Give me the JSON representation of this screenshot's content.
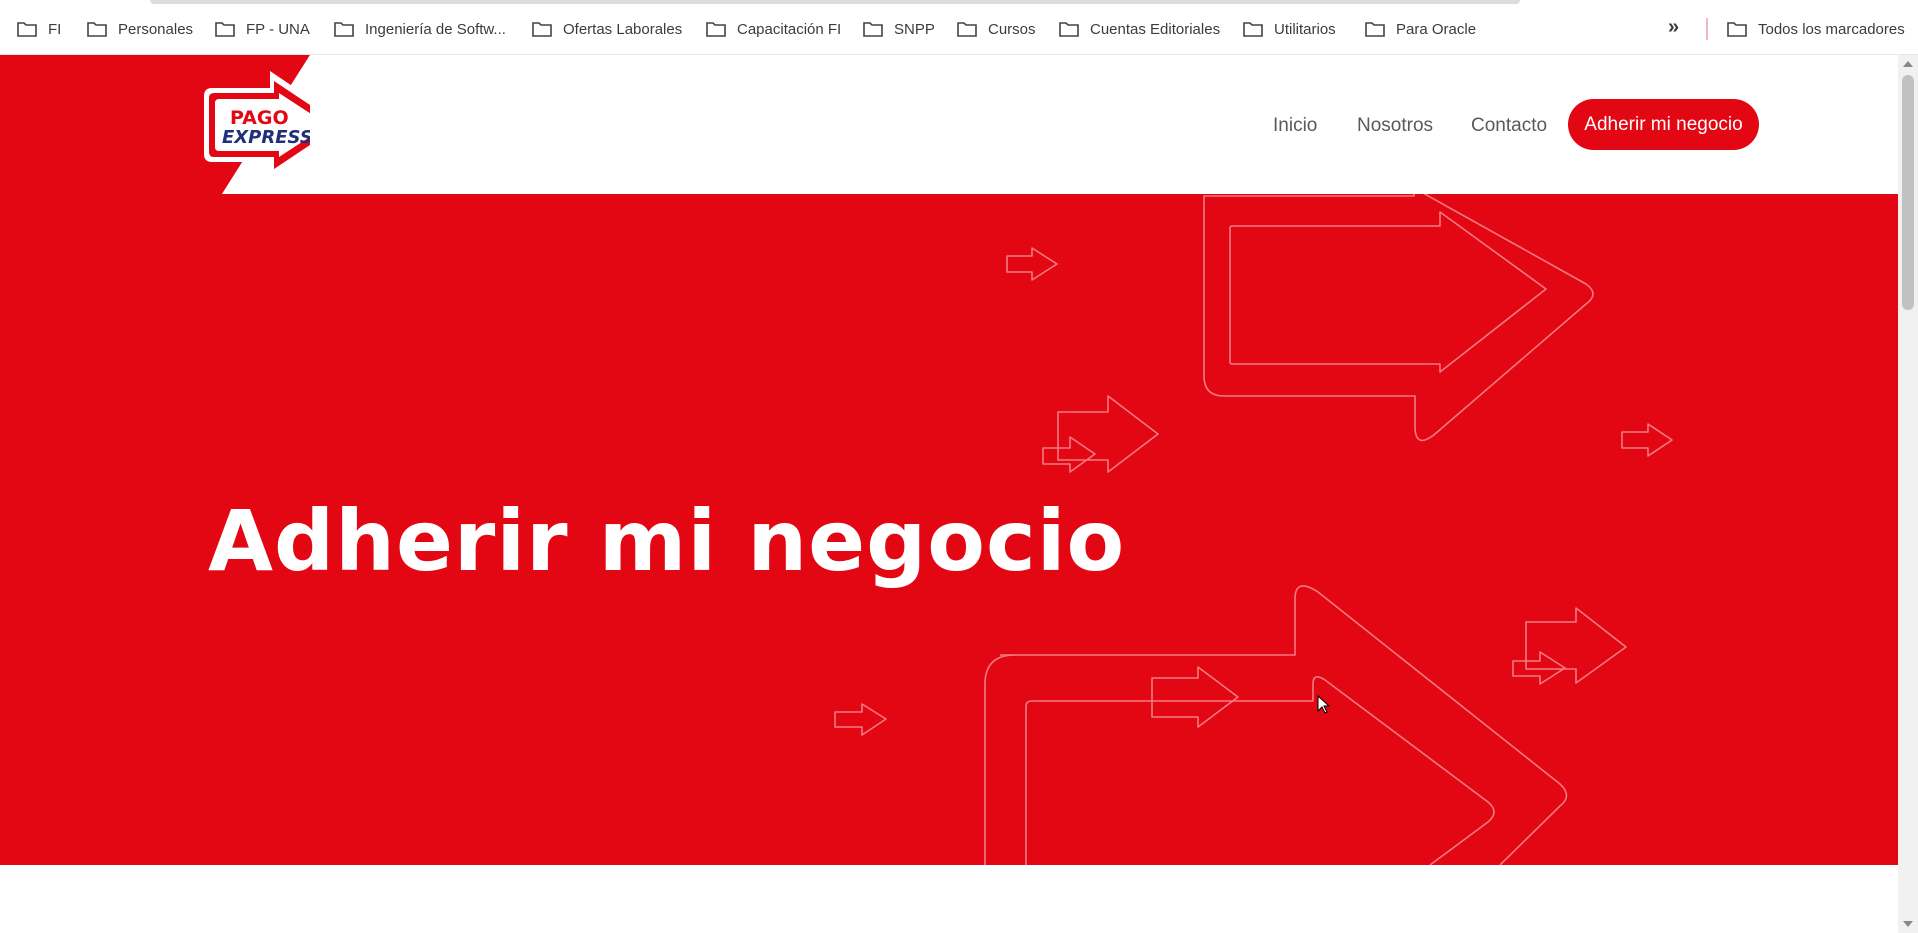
{
  "bookmarks": {
    "items": [
      "FI",
      "Personales",
      "FP - UNA",
      "Ingeniería de Softw...",
      "Ofertas Laborales",
      "Capacitación FI",
      "SNPP",
      "Cursos",
      "Cuentas Editoriales",
      "Utilitarios",
      "Para Oracle"
    ],
    "more_icon": "double-chevron-right-icon",
    "all_bookmarks": "Todos los marcadores"
  },
  "header": {
    "logo": {
      "line1": "PAGO",
      "line2": "EXPRESS",
      "mark": "®"
    },
    "nav": [
      "Inicio",
      "Nosotros",
      "Contacto"
    ],
    "cta_label": "Adherir mi negocio"
  },
  "hero": {
    "title": "Adherir mi negocio"
  },
  "colors": {
    "brand_red": "#e30613",
    "logo_blue": "#1f2f7a",
    "nav_text": "#5a5a5a"
  }
}
